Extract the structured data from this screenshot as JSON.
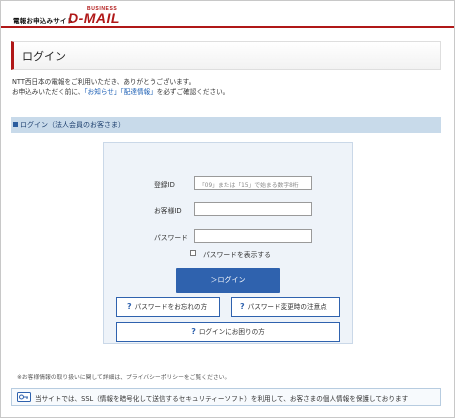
{
  "header": {
    "service_name": "電報お申込みサイト",
    "logo_business": "BUSINESS",
    "logo_dmail": "D-MAIL",
    "brand_color": "#b01818"
  },
  "page": {
    "title": "ログイン",
    "intro_line1": "NTT西日本の電報をご利用いただき、ありがとうございます。",
    "intro_line2_prefix": "お申込みいただく前に、",
    "intro_link_news": "「お知らせ」",
    "intro_link_delivery": "「配達情報」",
    "intro_line2_suffix": "を必ずご確認ください。"
  },
  "section": {
    "title": "ログイン（法人会員のお客さま）"
  },
  "login_form": {
    "registration_id_label": "登録ID",
    "registration_id_placeholder": "「09」または「15」で始まる数字8桁",
    "customer_id_label": "お客様ID",
    "customer_id_value": "",
    "password_label": "パスワード",
    "password_value": "",
    "show_password_label": "パスワードを表示する",
    "show_password_checked": false,
    "login_button": "＞ログイン",
    "forgot_password": "パスワードをお忘れの方",
    "password_change_notes": "パスワード変更時の注意点",
    "login_trouble": "ログインにお困りの方",
    "accent_color": "#2f62ae"
  },
  "footer": {
    "privacy_note": "※お客様情報の取り扱いに関して詳細は、プライバシーポリシーをご覧ください。",
    "ssl_notice": "当サイトでは、SSL（情報を暗号化して送信するセキュリティーソフト）を利用して、お客さまの個人情報を保護しております"
  }
}
